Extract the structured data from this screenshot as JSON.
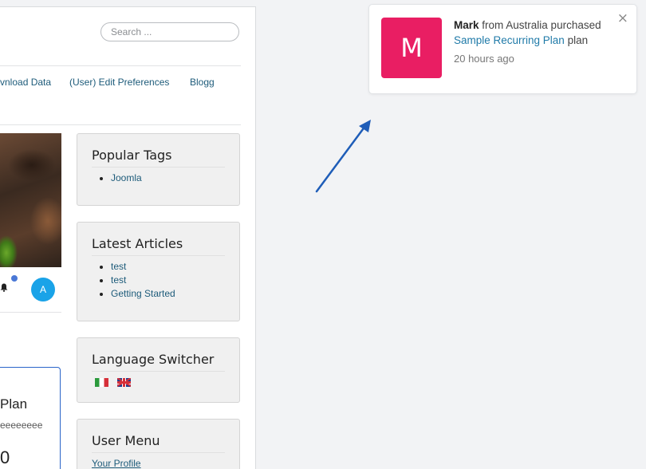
{
  "search": {
    "placeholder": "Search ..."
  },
  "nav": {
    "items": [
      "vnload Data",
      "(User) Edit Preferences",
      "Blogg"
    ]
  },
  "user_bar": {
    "avatar_letter": "A"
  },
  "plan": {
    "title": "Plan",
    "description": "eeeeeeee",
    "price": "0"
  },
  "modules": {
    "popular_tags": {
      "title": "Popular Tags",
      "items": [
        "Joomla"
      ]
    },
    "latest_articles": {
      "title": "Latest Articles",
      "items": [
        "test",
        "test",
        "Getting Started"
      ]
    },
    "language_switcher": {
      "title": "Language Switcher"
    },
    "user_menu": {
      "title": "User Menu",
      "first_link": "Your Profile"
    }
  },
  "notification": {
    "avatar_letter": "M",
    "name": "Mark",
    "text": "from Australia purchased",
    "product": "Sample Recurring Plan",
    "suffix": "plan",
    "time": "20 hours ago",
    "close": "×",
    "accent_color": "#e91e63",
    "link_color": "#1f7aa8"
  },
  "icons": [
    "bell-icon",
    "close-icon",
    "arrow-icon",
    "flag-italy-icon",
    "flag-uk-icon"
  ]
}
